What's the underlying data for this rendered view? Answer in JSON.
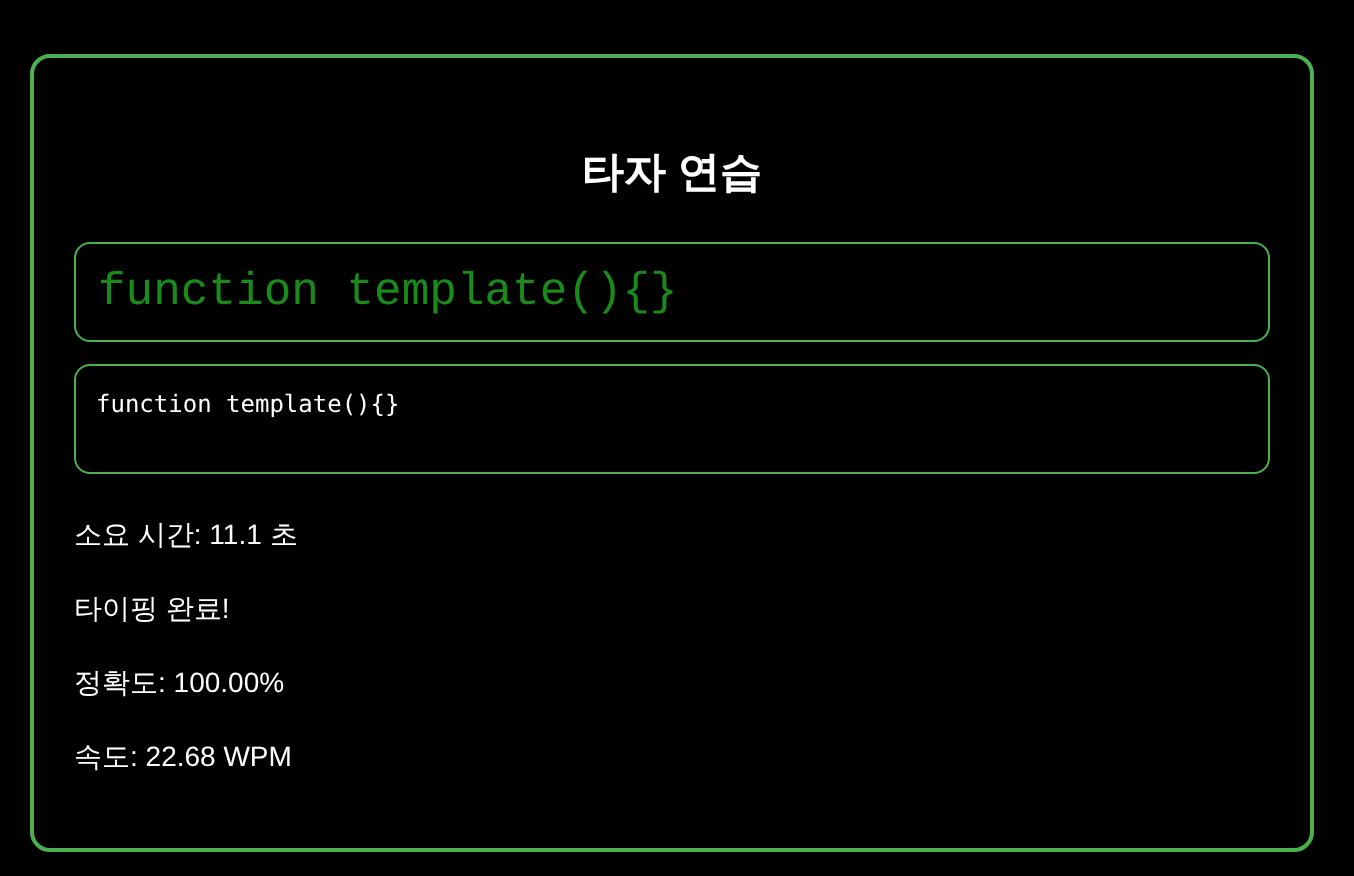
{
  "title": "타자 연습",
  "target_text": "function template(){}",
  "input": {
    "value": "function template(){}"
  },
  "results": [
    "소요 시간: 11.1 초",
    "타이핑 완료!",
    "정확도: 100.00%",
    "속도: 22.68 WPM"
  ]
}
